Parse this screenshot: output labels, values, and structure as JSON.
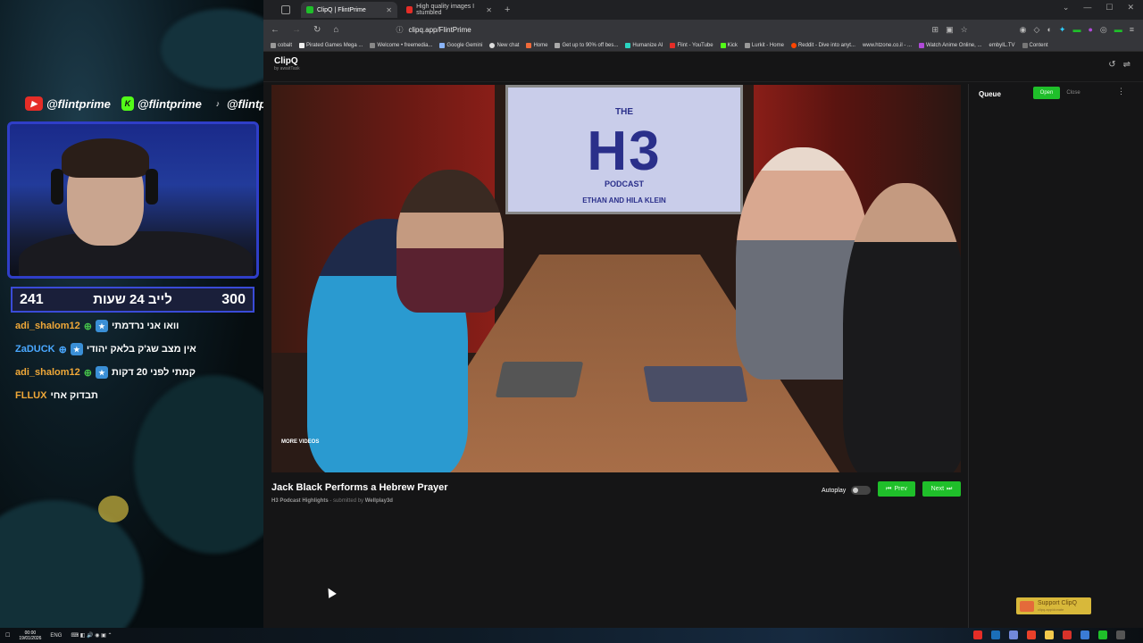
{
  "overlay": {
    "socials": [
      {
        "platform_icon": "youtube-icon",
        "handle": "@flintprime",
        "color": "#e52d27"
      },
      {
        "platform_icon": "kick-icon",
        "handle": "@flintprime",
        "color": "#53fc18"
      },
      {
        "platform_icon": "tiktok-icon",
        "handle": "@flintprime",
        "color": "#111111"
      }
    ],
    "scorebar": {
      "left_count": "241",
      "title": "לייב 24 שעות",
      "right_count": "300"
    },
    "chat": [
      {
        "user": "adi_shalom12",
        "message": "וואו אני נרדמתי",
        "user_color": "#f0a838"
      },
      {
        "user": "ZaDUCK",
        "message": "אין מצב שג'ק בלאק יהודי",
        "user_color": "#4aa8ff"
      },
      {
        "user": "adi_shalom12",
        "message": "קמתי לפני 20 דקות",
        "user_color": "#f0a838"
      },
      {
        "user": "FLLUX",
        "message": "תבדוק אחי",
        "user_color": "#f0a838"
      }
    ]
  },
  "browser": {
    "tabs": [
      {
        "label": "ClipQ | FlintPrime",
        "active": true
      },
      {
        "label": "High quality images I stumbled",
        "active": false
      }
    ],
    "url": "clipq.app/FlintPrime",
    "bookmarks": [
      "cobalt",
      "Pirated Games Mega ...",
      "Welcome • freemedia...",
      "Google Gemini",
      "New chat",
      "Home",
      "Get up to 90% off bes...",
      "Humanize AI",
      "Flint - YouTube",
      "Kick",
      "Lurkit - Home",
      "Reddit - Dive into anyt...",
      "www.htzone.co.il - ...",
      "Watch Anime Online, ...",
      "embyIL.TV",
      "Content"
    ]
  },
  "app": {
    "title": "ClipQ",
    "subtitle": "by awaitTask",
    "video": {
      "screen_the": "THE",
      "screen_logo": "H3",
      "screen_podcast": "PODCAST",
      "screen_hosts": "ETHAN AND HILA KLEIN",
      "more_videos": "MORE VIDEOS",
      "title": "Jack Black Performs a Hebrew Prayer",
      "channel": "H3 Podcast Highlights",
      "submitted_prefix": "- submitted by",
      "submitter": "Wellplay3d"
    },
    "controls": {
      "autoplay_label": "Autoplay",
      "autoplay_on": false,
      "prev_label": "Prev",
      "next_label": "Next"
    },
    "queue": {
      "title": "Queue",
      "open_label": "Open",
      "close_label": "Close"
    },
    "support": {
      "label": "Support ClipQ",
      "sub": "clipq.app/donate"
    }
  },
  "taskbar": {
    "time": "00:00",
    "date": "19/01/2026",
    "lang": "ENG"
  },
  "colors": {
    "accent_green": "#1fbf2a",
    "overlay_blue": "#3a4bd8",
    "chat_name_orange": "#f0a838"
  }
}
